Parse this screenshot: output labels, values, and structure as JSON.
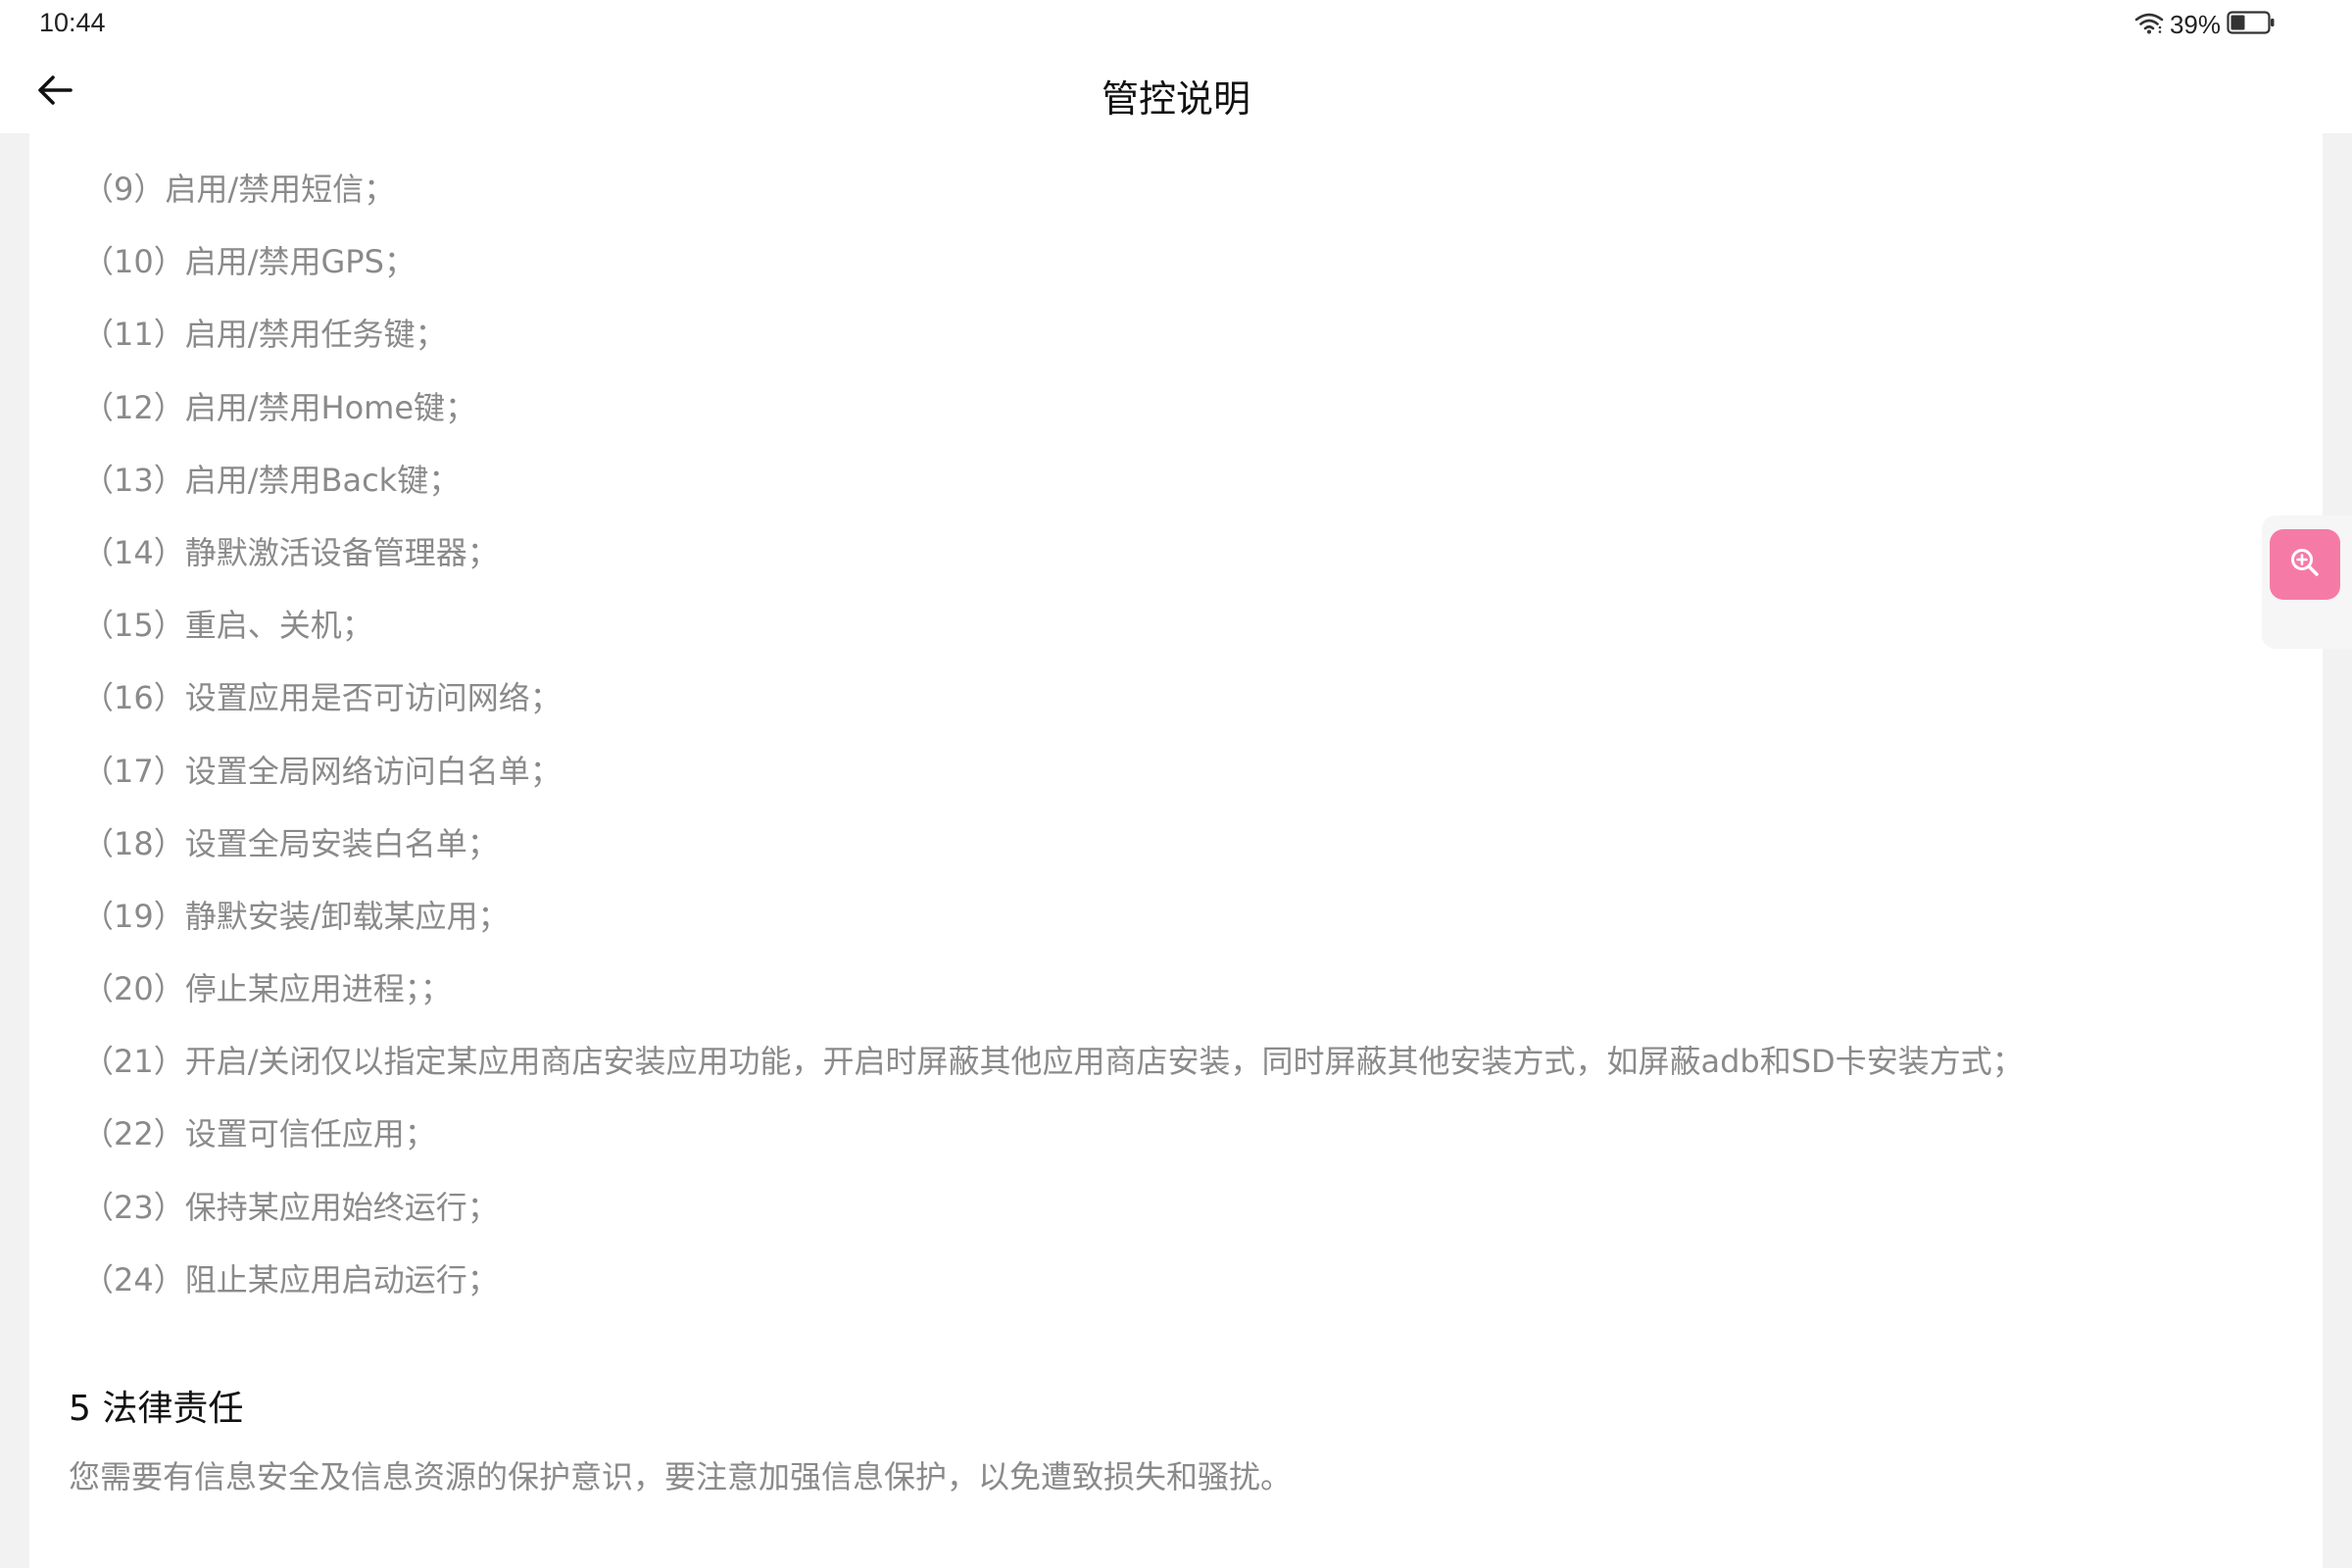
{
  "status_bar": {
    "time": "10:44",
    "battery_percent": "39%",
    "battery_level": 0.39,
    "icons": [
      "wifi-icon",
      "battery-icon"
    ]
  },
  "header": {
    "title": "管控说明",
    "back_icon": "arrow-left-icon"
  },
  "items": [
    "（9）启用/禁用短信；",
    "（10）启用/禁用GPS；",
    "（11）启用/禁用任务键；",
    "（12）启用/禁用Home键；",
    "（13）启用/禁用Back键；",
    "（14）静默激活设备管理器；",
    "（15）重启、关机；",
    "（16）设置应用是否可访问网络；",
    "（17）设置全局网络访问白名单；",
    "（18）设置全局安装白名单；",
    "（19）静默安装/卸载某应用；",
    "（20）停止某应用进程；；",
    "（21）开启/关闭仅以指定某应用商店安装应用功能，开启时屏蔽其他应用商店安装，同时屏蔽其他安装方式，如屏蔽adb和SD卡安装方式；",
    "（22）设置可信任应用；",
    "（23）保持某应用始终运行；",
    "（24）阻止某应用启动运行；"
  ],
  "section": {
    "title": "5 法律责任",
    "body": "您需要有信息安全及信息资源的保护意识，要注意加强信息保护，以免遭致损失和骚扰。"
  },
  "zoom_button": {
    "icon": "zoom-in-icon",
    "color": "#f57ba6"
  }
}
